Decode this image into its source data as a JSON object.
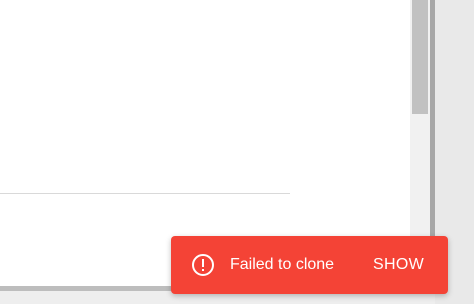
{
  "snackbar": {
    "message": "Failed to clone",
    "action_label": "SHOW",
    "icon": "error-icon",
    "background_color": "#f44336"
  }
}
